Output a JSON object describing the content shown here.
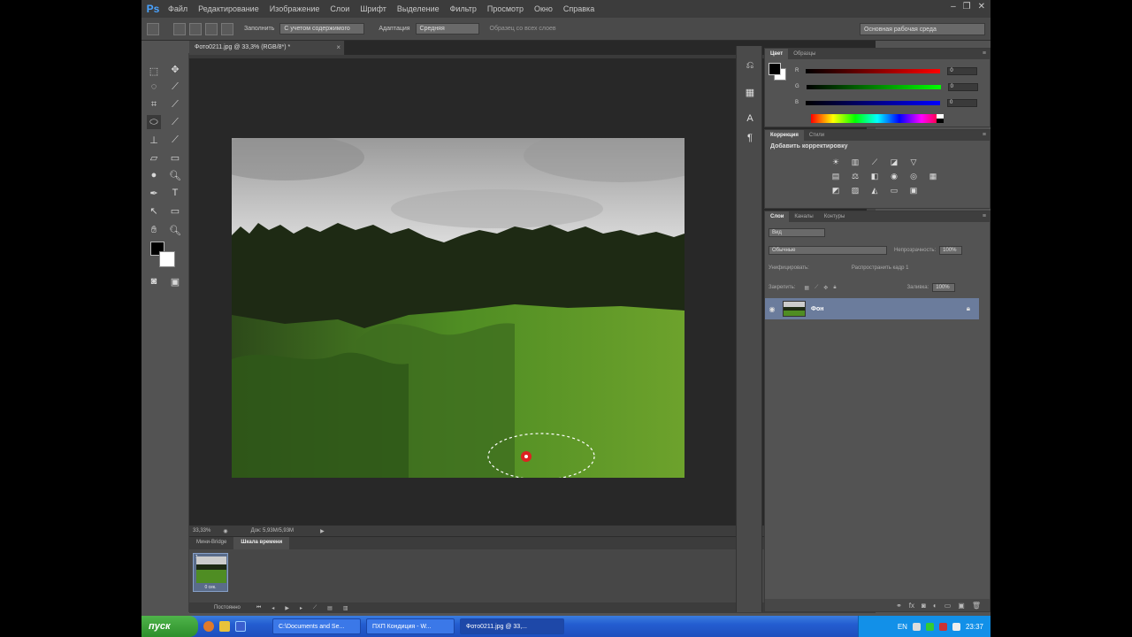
{
  "menubar": {
    "logo": "Ps",
    "items": [
      "Файл",
      "Редактирование",
      "Изображение",
      "Слои",
      "Шрифт",
      "Выделение",
      "Фильтр",
      "Просмотр",
      "Окно",
      "Справка"
    ],
    "window_buttons": [
      "–",
      "❐",
      "✕"
    ]
  },
  "options": {
    "label1": "Заполнить",
    "select1": "С учетом содержимого",
    "label2": "Адаптация",
    "select2": "Средняя",
    "checkbox": "Образец со всех слоев",
    "workspace": "Основная рабочая среда"
  },
  "document": {
    "tab_title": "Фото0211.jpg @ 33,3% (RGB/8*) *",
    "tab_close": "×",
    "zoom": "33,33%",
    "doc_info": "Док: 5,93M/5,93M"
  },
  "bottom_panel": {
    "tabs": [
      "Мини-Bridge",
      "Шкала времени"
    ],
    "frame_number": "1",
    "frame_delay": "0 сек.",
    "loop": "Постоянно"
  },
  "color_panel": {
    "tabs": [
      "Цвет",
      "Образцы"
    ],
    "channels": [
      {
        "name": "R",
        "value": "0",
        "gradient": "linear-gradient(to right, #000, #f00)"
      },
      {
        "name": "G",
        "value": "0",
        "gradient": "linear-gradient(to right, #000, #0f0)"
      },
      {
        "name": "B",
        "value": "0",
        "gradient": "linear-gradient(to right, #000, #00f)"
      }
    ]
  },
  "adjustments_panel": {
    "tabs": [
      "Коррекция",
      "Стили"
    ],
    "title": "Добавить корректировку"
  },
  "layers_panel": {
    "tabs": [
      "Слои",
      "Каналы",
      "Контуры"
    ],
    "kind": "Вид",
    "blend_mode": "Обычные",
    "opacity_label": "Непрозрачность:",
    "opacity": "100%",
    "unify_label": "Унифицировать:",
    "propagate": "Распространить кадр 1",
    "lock_label": "Закрепить:",
    "fill_label": "Заливка:",
    "fill": "100%",
    "layer_name": "Фон"
  },
  "taskbar": {
    "start": "пуск",
    "buttons": [
      "C:\\Documents and Se...",
      "ПХП Кондиция - W...",
      "Фото0211.jpg @ 33,..."
    ],
    "language": "EN",
    "clock": "23:37"
  },
  "colors": {
    "accent": "#4aa3ff",
    "selected_layer": "#6b7c9c",
    "taskbar": "#245dd0"
  }
}
